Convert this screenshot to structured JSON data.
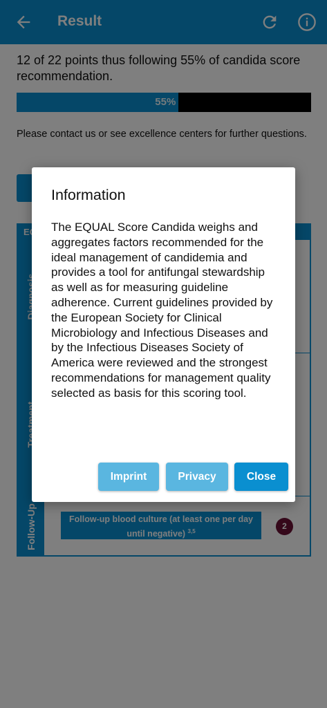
{
  "appbar": {
    "title": "Result",
    "back_icon": "arrow-left-icon",
    "refresh_icon": "refresh-icon",
    "info_icon": "info-icon"
  },
  "result": {
    "summary": "12 of 22 points thus following 55% of candida score recommendation.",
    "progress_percent": 55,
    "progress_label": "55%",
    "contact_text": "Please contact us or see excellence centers for further questions."
  },
  "table": {
    "header": "EQ",
    "sections": [
      "Diagnosis",
      "Treatment",
      "Follow-Up"
    ],
    "followup_item": "Follow-up blood culture (at least one per day until negative)",
    "followup_ref": "3,5",
    "followup_points": "2"
  },
  "dialog": {
    "title": "Information",
    "body": "The EQUAL Score Candida weighs and aggregates factors recommended for the ideal management of candidemia and provides a tool for antifungal stewardship as well as for measuring guideline adherence. Current guidelines provided by the European Society for Clinical Microbiology and Infectious Diseases and by the Infectious Diseases Society of America were reviewed and the strongest recommendations for management quality selected as basis for this scoring tool.",
    "buttons": {
      "imprint": "Imprint",
      "privacy": "Privacy",
      "close": "Close"
    }
  },
  "colors": {
    "primary": "#0a8fd0",
    "primary_light": "#5ab6e0",
    "badge": "#6b1035",
    "scrim": "rgba(0,0,0,0.5)"
  }
}
